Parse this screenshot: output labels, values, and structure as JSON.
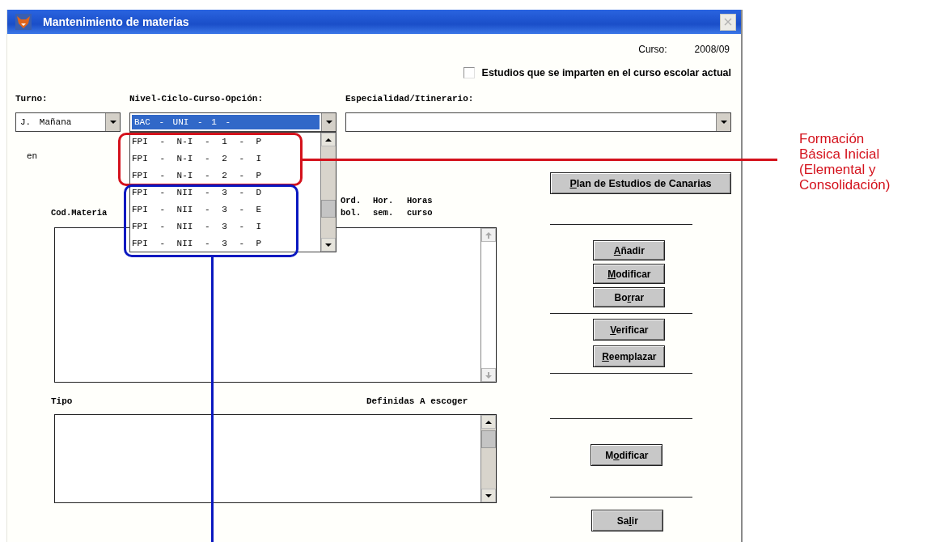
{
  "window": {
    "title": "Mantenimiento de materias",
    "close_disabled": true
  },
  "curso": {
    "label": "Curso:",
    "value": "2008/09"
  },
  "current_year_filter": {
    "label": "Estudios que se imparten en el curso escolar actual",
    "checked": false
  },
  "turno": {
    "label": "Turno:",
    "value": "J. Mañana"
  },
  "nivel": {
    "label": "Nivel-Ciclo-Curso-Opción:",
    "value": "BAC - UNI - 1 -",
    "expanded": true,
    "options": [
      {
        "text": "FPI - N-I - 1 - P",
        "selected": false
      },
      {
        "text": "FPI - N-I - 2 - I",
        "selected": false
      },
      {
        "text": "FPI - N-I - 2 - P",
        "selected": false
      },
      {
        "text": "FPI - NII - 3 - D",
        "selected": false
      },
      {
        "text": "FPI - NII - 3 - E",
        "selected": false
      },
      {
        "text": "FPI - NII - 3 - I",
        "selected": false
      },
      {
        "text": "FPI - NII - 3 - P",
        "selected": false
      }
    ]
  },
  "especialidad": {
    "label": "Especialidad/Itinerario:"
  },
  "en_label": "en",
  "plan_button": [
    {
      "text": "P",
      "underline": true
    },
    {
      "text": "lan de Estudios de Canarias",
      "underline": false
    }
  ],
  "materias_table": {
    "columns": [
      {
        "lines": [
          "Cod.Materia"
        ]
      },
      {
        "lines": [
          "Ord.",
          "bol."
        ]
      },
      {
        "lines": [
          "Hor.",
          "sem."
        ]
      },
      {
        "lines": [
          "Horas",
          "curso"
        ]
      }
    ]
  },
  "edit_buttons": [
    [
      {
        "text": "A",
        "underline": true
      },
      {
        "text": "ñadir",
        "underline": false
      }
    ],
    [
      {
        "text": "M",
        "underline": true
      },
      {
        "text": "odificar",
        "underline": false
      }
    ],
    [
      {
        "text": "Bo",
        "underline": false
      },
      {
        "text": "r",
        "underline": true
      },
      {
        "text": "rar",
        "underline": false
      }
    ]
  ],
  "check_buttons": [
    [
      {
        "text": "V",
        "underline": true
      },
      {
        "text": "erificar",
        "underline": false
      }
    ],
    [
      {
        "text": "R",
        "underline": true
      },
      {
        "text": "eemplazar",
        "underline": false
      }
    ]
  ],
  "tipo_table": {
    "tipo_label": "Tipo",
    "definidas_label": "Definidas A escoger"
  },
  "tipo_button": [
    {
      "text": "M",
      "underline": false
    },
    {
      "text": "o",
      "underline": true
    },
    {
      "text": "dificar",
      "underline": false
    }
  ],
  "exit_button": [
    {
      "text": "Sa",
      "underline": false
    },
    {
      "text": "l",
      "underline": true
    },
    {
      "text": "ir",
      "underline": false
    }
  ],
  "annotations": [
    {
      "kind": "red",
      "lines": [
        "Formación",
        "Básica Inicial",
        "(Elemental y",
        "Consolidación)"
      ]
    },
    {
      "kind": "blue"
    }
  ]
}
